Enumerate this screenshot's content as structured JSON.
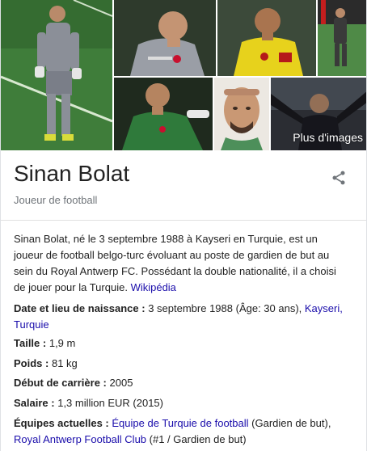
{
  "images": {
    "more_label": "Plus d'images"
  },
  "header": {
    "title": "Sinan Bolat",
    "subtitle": "Joueur de football"
  },
  "description": {
    "text": "Sinan Bolat, né le 3 septembre 1988 à Kayseri en Turquie, est un joueur de football belgo-turc évoluant au poste de gardien de but au sein du Royal Antwerp FC. Possédant la double nationalité, il a choisi de jouer pour la Turquie.",
    "source_link": "Wikipédia"
  },
  "facts": {
    "birth": {
      "label": "Date et lieu de naissance :",
      "value": "3 septembre 1988 (Âge: 30 ans),",
      "link": "Kayseri, Turquie"
    },
    "height": {
      "label": "Taille :",
      "value": "1,9 m"
    },
    "weight": {
      "label": "Poids :",
      "value": "81 kg"
    },
    "career_start": {
      "label": "Début de carrière :",
      "value": "2005"
    },
    "salary": {
      "label": "Salaire :",
      "value": "1,3 million EUR (2015)"
    },
    "teams": {
      "label": "Équipes actuelles :",
      "link1": "Équipe de Turquie de football",
      "role1": "(Gardien de but),",
      "link2": "Royal Antwerp Football Club",
      "role2": "(#1 / Gardien de but)"
    }
  },
  "icons": {
    "share": "share-icon"
  },
  "colors": {
    "link": "#1a0dab",
    "subtitle": "#70757a",
    "pitch_green": "#3f7d3a"
  }
}
